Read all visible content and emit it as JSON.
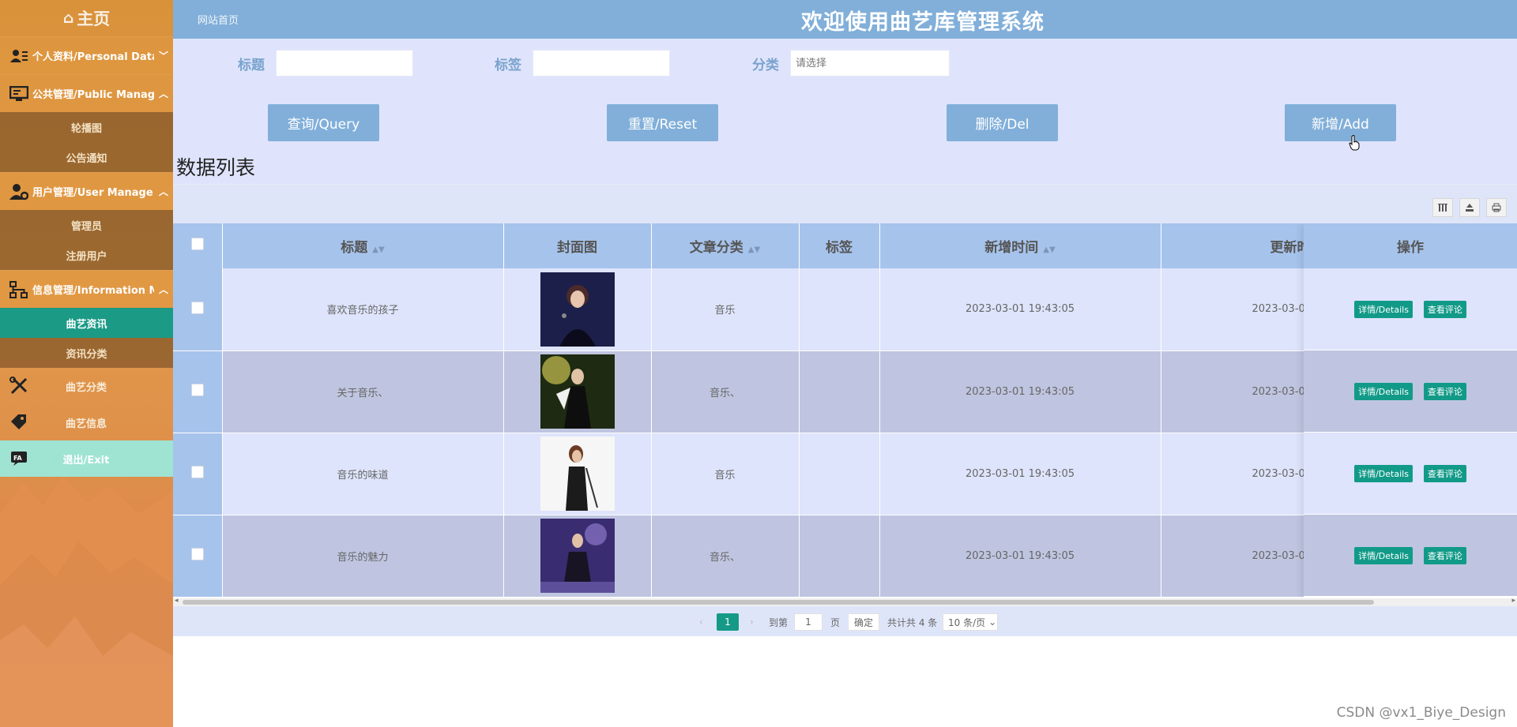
{
  "sidebar": {
    "home": "主页",
    "groups": [
      {
        "label": "个人资料/Personal Data",
        "icon": "id-card-icon",
        "chevron": "﹀"
      },
      {
        "label": "公共管理/Public Manage",
        "icon": "monitor-icon",
        "chevron": "︿",
        "items": [
          "轮播图",
          "公告通知"
        ]
      },
      {
        "label": "用户管理/User Manage",
        "icon": "user-gear-icon",
        "chevron": "︿",
        "items": [
          "管理员",
          "注册用户"
        ]
      },
      {
        "label": "信息管理/Information Manage",
        "icon": "sitemap-icon",
        "chevron": "︿",
        "items": [
          "曲艺资讯",
          "资讯分类"
        ]
      }
    ],
    "plain": [
      {
        "label": "曲艺分类",
        "icon": "tools-icon"
      },
      {
        "label": "曲艺信息",
        "icon": "tags-icon"
      },
      {
        "label": "退出/Exit",
        "icon": "exit-icon"
      }
    ]
  },
  "header": {
    "site_link": "网站首页",
    "title": "欢迎使用曲艺库管理系统"
  },
  "search": {
    "title_label": "标题",
    "tag_label": "标签",
    "category_label": "分类",
    "category_placeholder": "请选择",
    "buttons": {
      "query": "查询/Query",
      "reset": "重置/Reset",
      "delete": "删除/Del",
      "add": "新增/Add"
    },
    "list_title": "数据列表"
  },
  "table": {
    "columns": [
      "标题",
      "封面图",
      "文章分类",
      "标签",
      "新增时间",
      "更新时",
      "操作"
    ],
    "rows": [
      {
        "title": "喜欢音乐的孩子",
        "category": "音乐",
        "tag": "",
        "created": "2023-03-01 19:43:05",
        "updated": "2023-03-0"
      },
      {
        "title": "关于音乐、",
        "category": "音乐、",
        "tag": "",
        "created": "2023-03-01 19:43:05",
        "updated": "2023-03-0"
      },
      {
        "title": "音乐的味道",
        "category": "音乐",
        "tag": "",
        "created": "2023-03-01 19:43:05",
        "updated": "2023-03-0"
      },
      {
        "title": "音乐的魅力",
        "category": "音乐、",
        "tag": "",
        "created": "2023-03-01 19:43:05",
        "updated": "2023-03-0"
      }
    ],
    "row_actions": {
      "details": "详情/Details",
      "comments": "查看评论"
    }
  },
  "pagination": {
    "current": "1",
    "goto_prefix": "到第",
    "goto_value": "1",
    "goto_suffix": "页",
    "confirm": "确定",
    "total": "共计共 4 条",
    "page_size": "10 条/页"
  },
  "watermark": "CSDN @vx1_Biye_Design",
  "colors": {
    "header": "#81afd9",
    "accent": "#149a87",
    "sidebar": "#e19a49"
  }
}
